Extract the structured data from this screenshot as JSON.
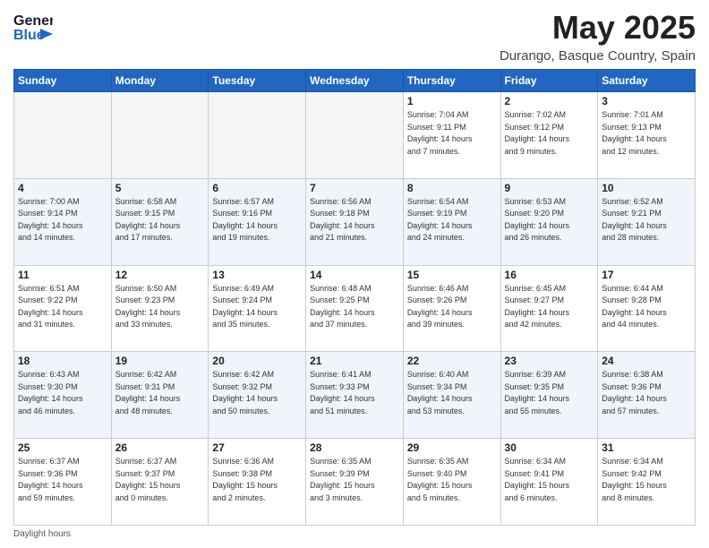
{
  "logo": {
    "line1": "General",
    "line2": "Blue"
  },
  "title": "May 2025",
  "subtitle": "Durango, Basque Country, Spain",
  "weekdays": [
    "Sunday",
    "Monday",
    "Tuesday",
    "Wednesday",
    "Thursday",
    "Friday",
    "Saturday"
  ],
  "footer_label": "Daylight hours",
  "weeks": [
    [
      {
        "day": "",
        "info": ""
      },
      {
        "day": "",
        "info": ""
      },
      {
        "day": "",
        "info": ""
      },
      {
        "day": "",
        "info": ""
      },
      {
        "day": "1",
        "info": "Sunrise: 7:04 AM\nSunset: 9:11 PM\nDaylight: 14 hours\nand 7 minutes."
      },
      {
        "day": "2",
        "info": "Sunrise: 7:02 AM\nSunset: 9:12 PM\nDaylight: 14 hours\nand 9 minutes."
      },
      {
        "day": "3",
        "info": "Sunrise: 7:01 AM\nSunset: 9:13 PM\nDaylight: 14 hours\nand 12 minutes."
      }
    ],
    [
      {
        "day": "4",
        "info": "Sunrise: 7:00 AM\nSunset: 9:14 PM\nDaylight: 14 hours\nand 14 minutes."
      },
      {
        "day": "5",
        "info": "Sunrise: 6:58 AM\nSunset: 9:15 PM\nDaylight: 14 hours\nand 17 minutes."
      },
      {
        "day": "6",
        "info": "Sunrise: 6:57 AM\nSunset: 9:16 PM\nDaylight: 14 hours\nand 19 minutes."
      },
      {
        "day": "7",
        "info": "Sunrise: 6:56 AM\nSunset: 9:18 PM\nDaylight: 14 hours\nand 21 minutes."
      },
      {
        "day": "8",
        "info": "Sunrise: 6:54 AM\nSunset: 9:19 PM\nDaylight: 14 hours\nand 24 minutes."
      },
      {
        "day": "9",
        "info": "Sunrise: 6:53 AM\nSunset: 9:20 PM\nDaylight: 14 hours\nand 26 minutes."
      },
      {
        "day": "10",
        "info": "Sunrise: 6:52 AM\nSunset: 9:21 PM\nDaylight: 14 hours\nand 28 minutes."
      }
    ],
    [
      {
        "day": "11",
        "info": "Sunrise: 6:51 AM\nSunset: 9:22 PM\nDaylight: 14 hours\nand 31 minutes."
      },
      {
        "day": "12",
        "info": "Sunrise: 6:50 AM\nSunset: 9:23 PM\nDaylight: 14 hours\nand 33 minutes."
      },
      {
        "day": "13",
        "info": "Sunrise: 6:49 AM\nSunset: 9:24 PM\nDaylight: 14 hours\nand 35 minutes."
      },
      {
        "day": "14",
        "info": "Sunrise: 6:48 AM\nSunset: 9:25 PM\nDaylight: 14 hours\nand 37 minutes."
      },
      {
        "day": "15",
        "info": "Sunrise: 6:46 AM\nSunset: 9:26 PM\nDaylight: 14 hours\nand 39 minutes."
      },
      {
        "day": "16",
        "info": "Sunrise: 6:45 AM\nSunset: 9:27 PM\nDaylight: 14 hours\nand 42 minutes."
      },
      {
        "day": "17",
        "info": "Sunrise: 6:44 AM\nSunset: 9:28 PM\nDaylight: 14 hours\nand 44 minutes."
      }
    ],
    [
      {
        "day": "18",
        "info": "Sunrise: 6:43 AM\nSunset: 9:30 PM\nDaylight: 14 hours\nand 46 minutes."
      },
      {
        "day": "19",
        "info": "Sunrise: 6:42 AM\nSunset: 9:31 PM\nDaylight: 14 hours\nand 48 minutes."
      },
      {
        "day": "20",
        "info": "Sunrise: 6:42 AM\nSunset: 9:32 PM\nDaylight: 14 hours\nand 50 minutes."
      },
      {
        "day": "21",
        "info": "Sunrise: 6:41 AM\nSunset: 9:33 PM\nDaylight: 14 hours\nand 51 minutes."
      },
      {
        "day": "22",
        "info": "Sunrise: 6:40 AM\nSunset: 9:34 PM\nDaylight: 14 hours\nand 53 minutes."
      },
      {
        "day": "23",
        "info": "Sunrise: 6:39 AM\nSunset: 9:35 PM\nDaylight: 14 hours\nand 55 minutes."
      },
      {
        "day": "24",
        "info": "Sunrise: 6:38 AM\nSunset: 9:36 PM\nDaylight: 14 hours\nand 57 minutes."
      }
    ],
    [
      {
        "day": "25",
        "info": "Sunrise: 6:37 AM\nSunset: 9:36 PM\nDaylight: 14 hours\nand 59 minutes."
      },
      {
        "day": "26",
        "info": "Sunrise: 6:37 AM\nSunset: 9:37 PM\nDaylight: 15 hours\nand 0 minutes."
      },
      {
        "day": "27",
        "info": "Sunrise: 6:36 AM\nSunset: 9:38 PM\nDaylight: 15 hours\nand 2 minutes."
      },
      {
        "day": "28",
        "info": "Sunrise: 6:35 AM\nSunset: 9:39 PM\nDaylight: 15 hours\nand 3 minutes."
      },
      {
        "day": "29",
        "info": "Sunrise: 6:35 AM\nSunset: 9:40 PM\nDaylight: 15 hours\nand 5 minutes."
      },
      {
        "day": "30",
        "info": "Sunrise: 6:34 AM\nSunset: 9:41 PM\nDaylight: 15 hours\nand 6 minutes."
      },
      {
        "day": "31",
        "info": "Sunrise: 6:34 AM\nSunset: 9:42 PM\nDaylight: 15 hours\nand 8 minutes."
      }
    ]
  ]
}
